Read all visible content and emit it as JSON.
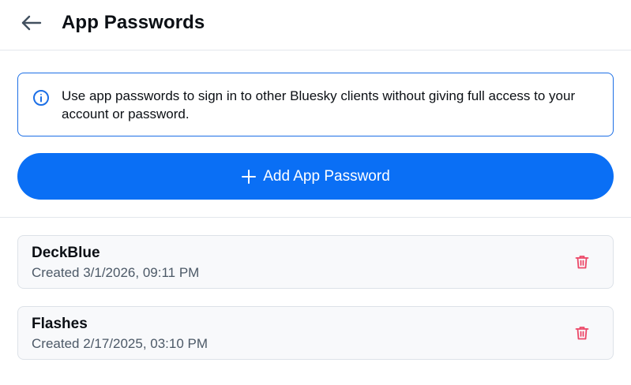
{
  "header": {
    "title": "App Passwords",
    "back_icon": "arrow-left-icon"
  },
  "info": {
    "icon": "info-circle-icon",
    "text": "Use app passwords to sign in to other Bluesky clients without giving full access to your account or password."
  },
  "add_button": {
    "icon": "plus-icon",
    "label": "Add App Password"
  },
  "passwords": [
    {
      "name": "DeckBlue",
      "created": "Created 3/1/2026, 09:11 PM",
      "delete_icon": "trash-icon"
    },
    {
      "name": "Flashes",
      "created": "Created 2/17/2025, 03:10 PM",
      "delete_icon": "trash-icon"
    }
  ],
  "colors": {
    "accent": "#0a6ff5",
    "info_border": "#1c6fe6",
    "delete": "#ec4868",
    "muted_text": "#4c5967"
  }
}
